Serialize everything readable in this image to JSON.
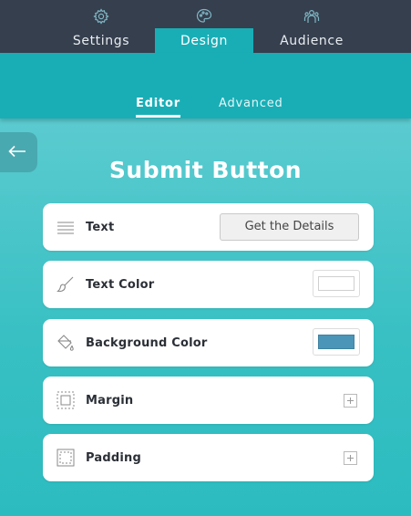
{
  "tabs": {
    "settings": "Settings",
    "design": "Design",
    "audience": "Audience"
  },
  "subtabs": {
    "editor": "Editor",
    "advanced": "Advanced"
  },
  "page_title": "Submit Button",
  "rows": {
    "text": {
      "label": "Text",
      "value": "Get the Details"
    },
    "text_color": {
      "label": "Text Color",
      "color": "#ffffff"
    },
    "background_color": {
      "label": "Background Color",
      "color": "#4b95b8"
    },
    "margin": {
      "label": "Margin"
    },
    "padding": {
      "label": "Padding"
    }
  },
  "icons": {
    "settings": "gear-icon",
    "design": "palette-icon",
    "audience": "people-icon",
    "back": "arrow-left-icon",
    "text": "text-lines-icon",
    "text_color": "brush-icon",
    "background_color": "paint-bucket-icon",
    "margin": "margin-box-icon",
    "padding": "padding-box-icon",
    "expand": "plus-icon"
  },
  "colors": {
    "topbar": "#363f4e",
    "accent": "#19aeb6"
  }
}
